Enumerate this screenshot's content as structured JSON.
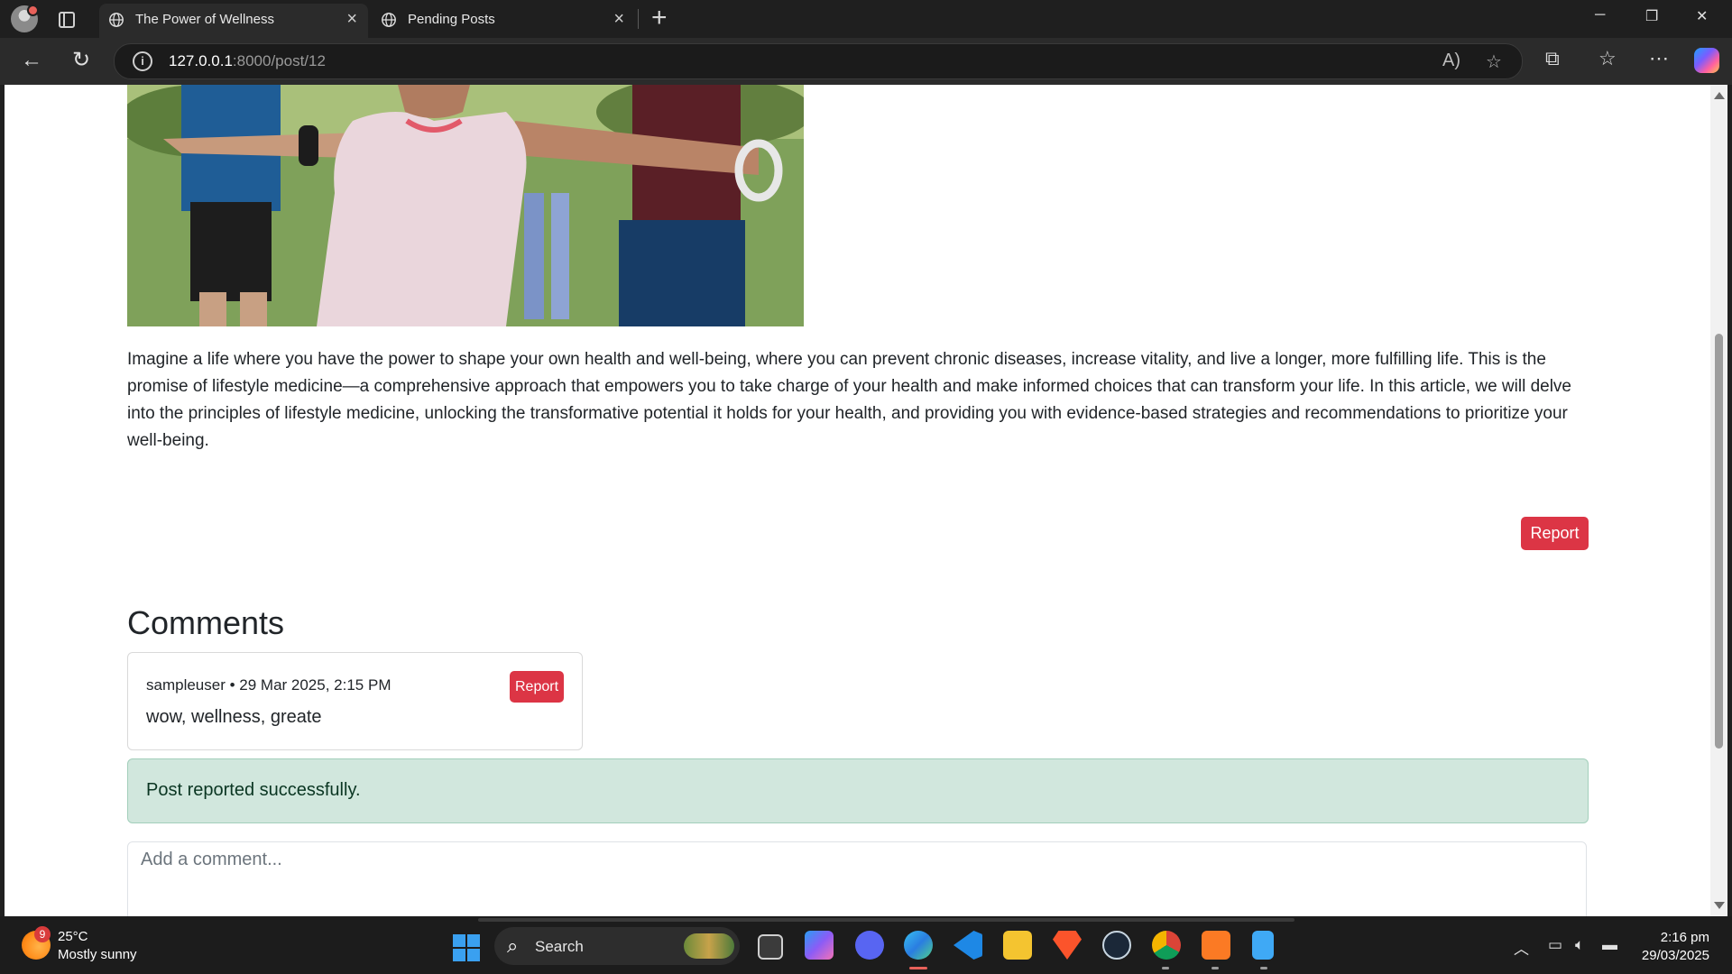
{
  "browser": {
    "tabs": [
      {
        "title": "The Power of Wellness",
        "active": true
      },
      {
        "title": "Pending Posts",
        "active": false
      }
    ],
    "address": {
      "host": "127.0.0.1",
      "path": ":8000/post/12"
    },
    "window_controls": {
      "minimize": "─",
      "restore": "❐",
      "close": "✕"
    }
  },
  "post": {
    "article_text": "Imagine a life where you have the power to shape your own health and well-being, where you can prevent chronic diseases, increase vitality, and live a longer, more fulfilling life. This is the promise of lifestyle medicine—a comprehensive approach that empowers you to take charge of your health and make informed choices that can transform your life. In this article, we will delve into the principles of lifestyle medicine, unlocking the transformative potential it holds for your health, and providing you with evidence-based strategies and recommendations to prioritize your well-being.",
    "report_label": "Report"
  },
  "comments": {
    "heading": "Comments",
    "items": [
      {
        "author": "sampleuser",
        "date": "29 Mar 2025, 2:15 PM",
        "meta": "sampleuser • 29 Mar 2025, 2:15 PM",
        "text": "wow, wellness, greate",
        "report_label": "Report"
      }
    ],
    "alert": "Post reported successfully.",
    "input_placeholder": "Add a comment..."
  },
  "taskbar": {
    "weather": {
      "badge": "9",
      "temp": "25°C",
      "desc": "Mostly sunny"
    },
    "search_label": "Search",
    "clock": {
      "time": "2:16 pm",
      "date": "29/03/2025"
    }
  },
  "colors": {
    "danger": "#dc3545",
    "success_bg": "#d1e7dd",
    "success_text": "#0a3622"
  }
}
